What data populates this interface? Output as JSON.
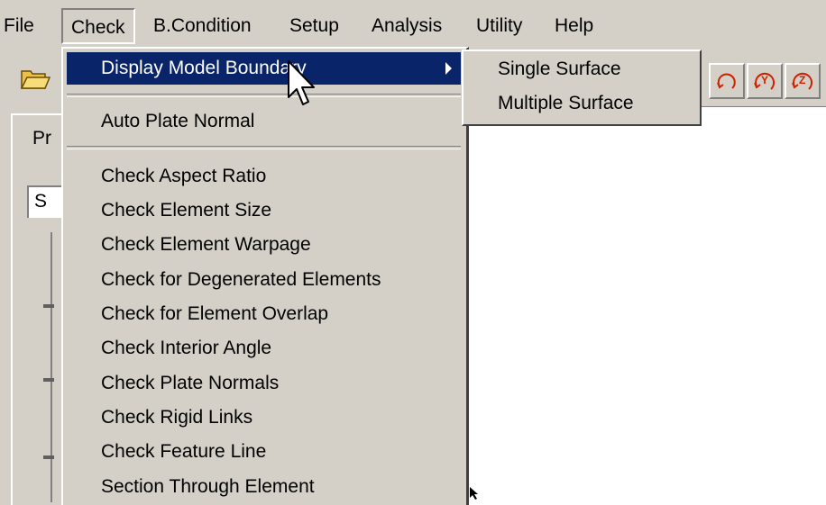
{
  "menubar": {
    "items": [
      {
        "label": "File"
      },
      {
        "label": "Check"
      },
      {
        "label": "B.Condition"
      },
      {
        "label": "Setup"
      },
      {
        "label": "Analysis"
      },
      {
        "label": "Utility"
      },
      {
        "label": "Help"
      }
    ]
  },
  "toolbar": {
    "open_icon": "folder-open-icon",
    "rotate_buttons": [
      {
        "icon": "rotate-icon",
        "label": ""
      },
      {
        "icon": "rotate-y-icon",
        "label": "Y"
      },
      {
        "icon": "rotate-z-icon",
        "label": "Z"
      }
    ]
  },
  "left_panel": {
    "tab_label": "Pr",
    "combo_value": "S"
  },
  "check_menu": {
    "items": [
      {
        "label": "Display Model Boundary",
        "has_submenu": true,
        "highlighted": true
      },
      {
        "label": "Auto Plate Normal"
      },
      {
        "label": "Check Aspect Ratio"
      },
      {
        "label": "Check Element Size"
      },
      {
        "label": "Check Element Warpage"
      },
      {
        "label": "Check for Degenerated Elements"
      },
      {
        "label": "Check for Element Overlap"
      },
      {
        "label": "Check Interior Angle"
      },
      {
        "label": "Check Plate Normals"
      },
      {
        "label": "Check Rigid Links"
      },
      {
        "label": "Check Feature Line"
      },
      {
        "label": "Section Through Element"
      }
    ]
  },
  "submenu": {
    "items": [
      {
        "label": "Single Surface"
      },
      {
        "label": "Multiple Surface"
      }
    ]
  },
  "colors": {
    "menu_bg": "#d4d0c8",
    "highlight": "#0a246a",
    "highlight_text": "#ffffff"
  }
}
